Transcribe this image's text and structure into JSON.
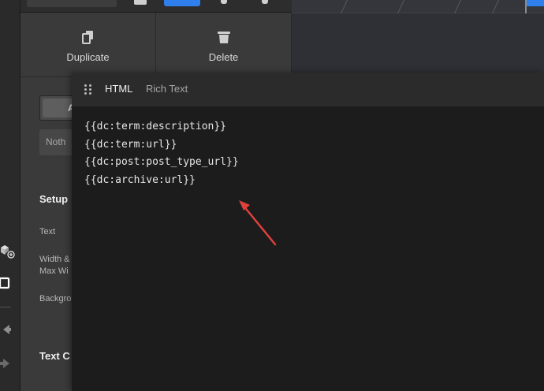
{
  "sidebar": {
    "actions": [
      {
        "label": "Duplicate",
        "icon": "duplicate-icon"
      },
      {
        "label": "Delete",
        "icon": "trash-icon"
      }
    ],
    "tab_fragment": "A",
    "select_fragment": "Noth",
    "setup_heading": "Setup",
    "labels": {
      "text": "Text",
      "width_line1": "Width &",
      "width_line2": "Max Wi",
      "background": "Backgro"
    },
    "text_heading": "Text C"
  },
  "editor": {
    "tabs": [
      {
        "label": "HTML",
        "active": true
      },
      {
        "label": "Rich Text",
        "active": false
      }
    ],
    "code_lines": [
      "{{dc:term:description}}",
      "{{dc:term:url}}",
      "{{dc:post:post_type_url}}",
      "{{dc:archive:url}}"
    ]
  },
  "colors": {
    "accent": "#2f80ed",
    "annotation_arrow": "#e0413a"
  }
}
